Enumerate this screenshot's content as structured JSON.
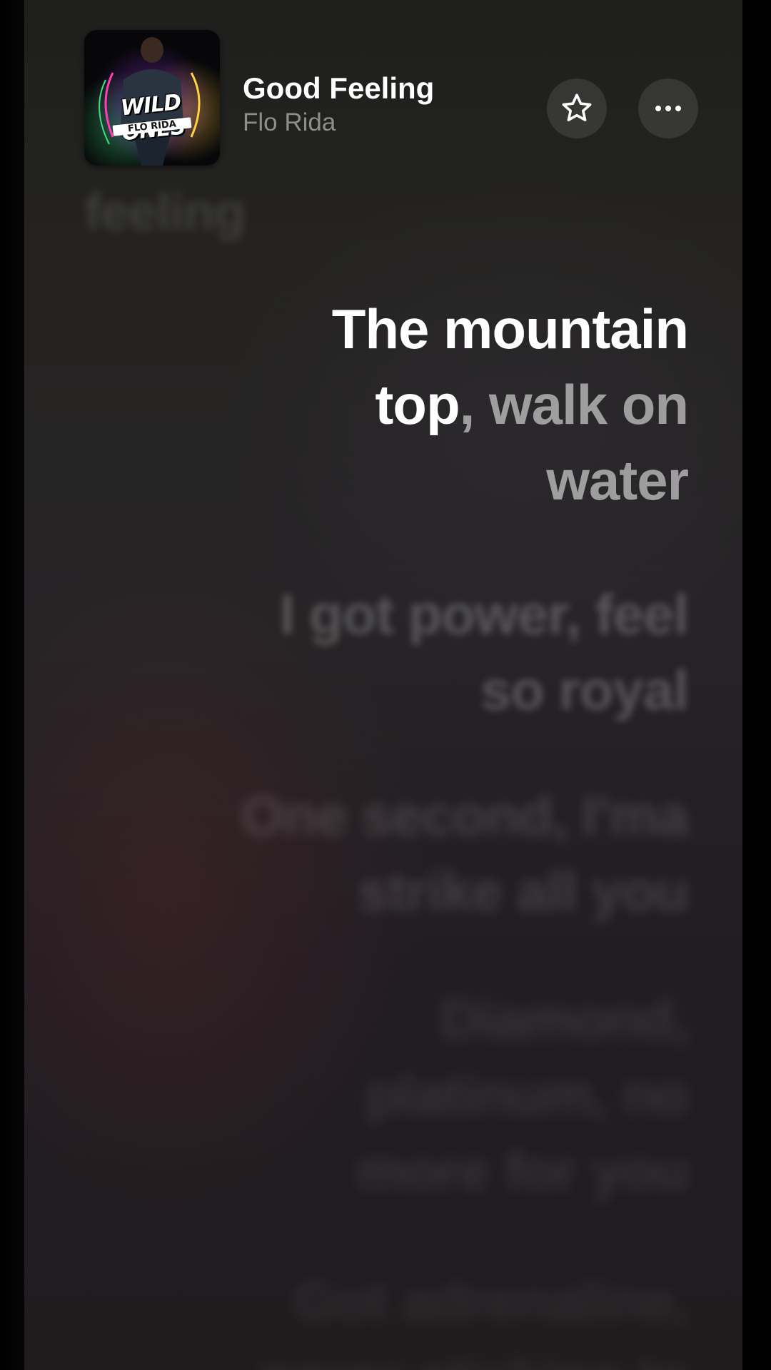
{
  "now_playing": {
    "title": "Good Feeling",
    "artist": "Flo Rida",
    "album_logo_text": "WILD ONES",
    "album_sub_text": "FLO RIDA"
  },
  "actions": {
    "favorite_icon": "star-icon",
    "more_icon": "ellipsis-icon"
  },
  "lyrics": {
    "previous": "feeling",
    "current_sung": "The mountain top",
    "current_unsung": ", walk on water",
    "next": [
      "I got power, feel so royal",
      "One second, I'ma strike all you",
      "Diamond, platinum, no more for you",
      "Got adrenaline, never sticking to"
    ]
  },
  "colors": {
    "background_top": "#1e1f1c",
    "background_bottom": "#1f1c1e",
    "text_primary": "#ffffff",
    "text_secondary": "#8d8d8b"
  }
}
